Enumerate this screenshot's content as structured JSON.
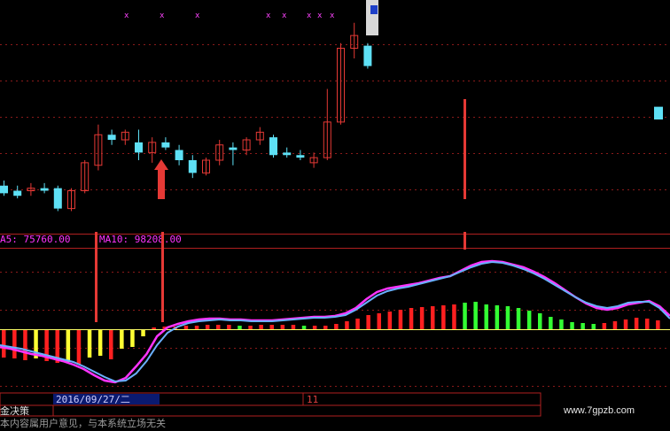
{
  "chart_data": [
    {
      "type": "candlestick",
      "panel": "price",
      "up_color": "#e53935",
      "down_color": "#5ee0f5",
      "grid": true,
      "markers": [
        "x",
        "x",
        "x",
        "x x",
        "x x x"
      ],
      "candles": [
        {
          "o": 34,
          "h": 36,
          "l": 30,
          "c": 31
        },
        {
          "o": 32,
          "h": 34,
          "l": 29,
          "c": 30
        },
        {
          "o": 32,
          "h": 35,
          "l": 30,
          "c": 33
        },
        {
          "o": 33,
          "h": 35,
          "l": 31,
          "c": 32
        },
        {
          "o": 33,
          "h": 34,
          "l": 24,
          "c": 25
        },
        {
          "o": 25,
          "h": 33,
          "l": 24,
          "c": 32
        },
        {
          "o": 32,
          "h": 44,
          "l": 31,
          "c": 43
        },
        {
          "o": 42,
          "h": 58,
          "l": 40,
          "c": 54
        },
        {
          "o": 54,
          "h": 56,
          "l": 50,
          "c": 52
        },
        {
          "o": 52,
          "h": 56,
          "l": 50,
          "c": 55
        },
        {
          "o": 51,
          "h": 56,
          "l": 44,
          "c": 47
        },
        {
          "o": 47,
          "h": 53,
          "l": 43,
          "c": 51
        },
        {
          "o": 51,
          "h": 53,
          "l": 48,
          "c": 49
        },
        {
          "o": 48,
          "h": 50,
          "l": 42,
          "c": 44
        },
        {
          "o": 44,
          "h": 46,
          "l": 37,
          "c": 39
        },
        {
          "o": 39,
          "h": 45,
          "l": 38,
          "c": 44
        },
        {
          "o": 44,
          "h": 52,
          "l": 42,
          "c": 50
        },
        {
          "o": 49,
          "h": 51,
          "l": 42,
          "c": 48
        },
        {
          "o": 48,
          "h": 53,
          "l": 46,
          "c": 52
        },
        {
          "o": 52,
          "h": 57,
          "l": 50,
          "c": 55
        },
        {
          "o": 53,
          "h": 54,
          "l": 45,
          "c": 46
        },
        {
          "o": 47,
          "h": 49,
          "l": 45,
          "c": 46
        },
        {
          "o": 46,
          "h": 48,
          "l": 44,
          "c": 45
        },
        {
          "o": 43,
          "h": 47,
          "l": 41,
          "c": 45
        },
        {
          "o": 45,
          "h": 72,
          "l": 44,
          "c": 59
        },
        {
          "o": 59,
          "h": 90,
          "l": 58,
          "c": 88
        },
        {
          "o": 88,
          "h": 98,
          "l": 84,
          "c": 93
        },
        {
          "o": 89,
          "h": 90,
          "l": 80,
          "c": 81
        }
      ],
      "partial_candles": [
        {
          "x_index": 42,
          "o": 65,
          "h": 65,
          "l": 60,
          "c": 60
        }
      ],
      "arrow_index": 9
    },
    {
      "type": "histogram+line",
      "panel": "indicator",
      "header": {
        "ma5_label": "A5: 75760.00",
        "ma10_label": "MA10: 98208.00"
      },
      "ma5_color": "#ffffff",
      "ma10_color": "#ff33ff",
      "bar_colors": {
        "pos_up": "#ff2020",
        "pos_down": "#33ff33",
        "neg_up": "#ff2020",
        "neg_down": "#ffff33"
      },
      "zero_line_color": "#ffff66",
      "values": [
        -32,
        -33,
        -35,
        -33,
        -36,
        -38,
        -37,
        -40,
        -32,
        -30,
        -34,
        -22,
        -20,
        -8,
        2,
        3,
        3,
        4,
        4,
        5,
        5,
        5,
        4,
        4,
        5,
        5,
        5,
        5,
        4,
        4,
        4,
        6,
        9,
        12,
        16,
        18,
        20,
        22,
        24,
        25,
        26,
        27,
        28,
        30,
        31,
        28,
        27,
        26,
        24,
        21,
        18,
        14,
        11,
        8,
        7,
        6,
        7,
        9,
        11,
        13,
        12,
        10
      ],
      "line_magenta": [
        -20,
        -22,
        -25,
        -28,
        -30,
        -33,
        -36,
        -40,
        -45,
        -52,
        -58,
        -60,
        -55,
        -42,
        -28,
        -8,
        2,
        6,
        9,
        11,
        12,
        12,
        11,
        11,
        10,
        10,
        10,
        11,
        12,
        13,
        14,
        14,
        15,
        18,
        24,
        34,
        42,
        46,
        48,
        50,
        52,
        55,
        58,
        60,
        66,
        72,
        76,
        77,
        76,
        73,
        70,
        65,
        59,
        52,
        44,
        36,
        29,
        24,
        22,
        24,
        28,
        30,
        32,
        26,
        15
      ],
      "line_blue": [
        -18,
        -20,
        -22,
        -25,
        -28,
        -31,
        -34,
        -37,
        -42,
        -48,
        -54,
        -59,
        -58,
        -50,
        -36,
        -18,
        -4,
        3,
        7,
        9,
        10,
        11,
        10,
        10,
        9,
        9,
        9,
        10,
        11,
        12,
        13,
        13,
        14,
        16,
        22,
        30,
        38,
        43,
        46,
        48,
        51,
        54,
        57,
        60,
        65,
        70,
        74,
        76,
        75,
        72,
        68,
        63,
        57,
        50,
        43,
        36,
        30,
        26,
        24,
        26,
        30,
        31,
        31,
        24,
        12
      ],
      "spikes": [
        6,
        10
      ]
    }
  ],
  "date_bar": {
    "date_text": "2016/09/27/二",
    "right_text": "11"
  },
  "status_bar": {
    "left_text": "金决策",
    "disclaimer": "本内容属用户意见，与本系统立场无关"
  },
  "watermark": "www.7gpzb.com"
}
